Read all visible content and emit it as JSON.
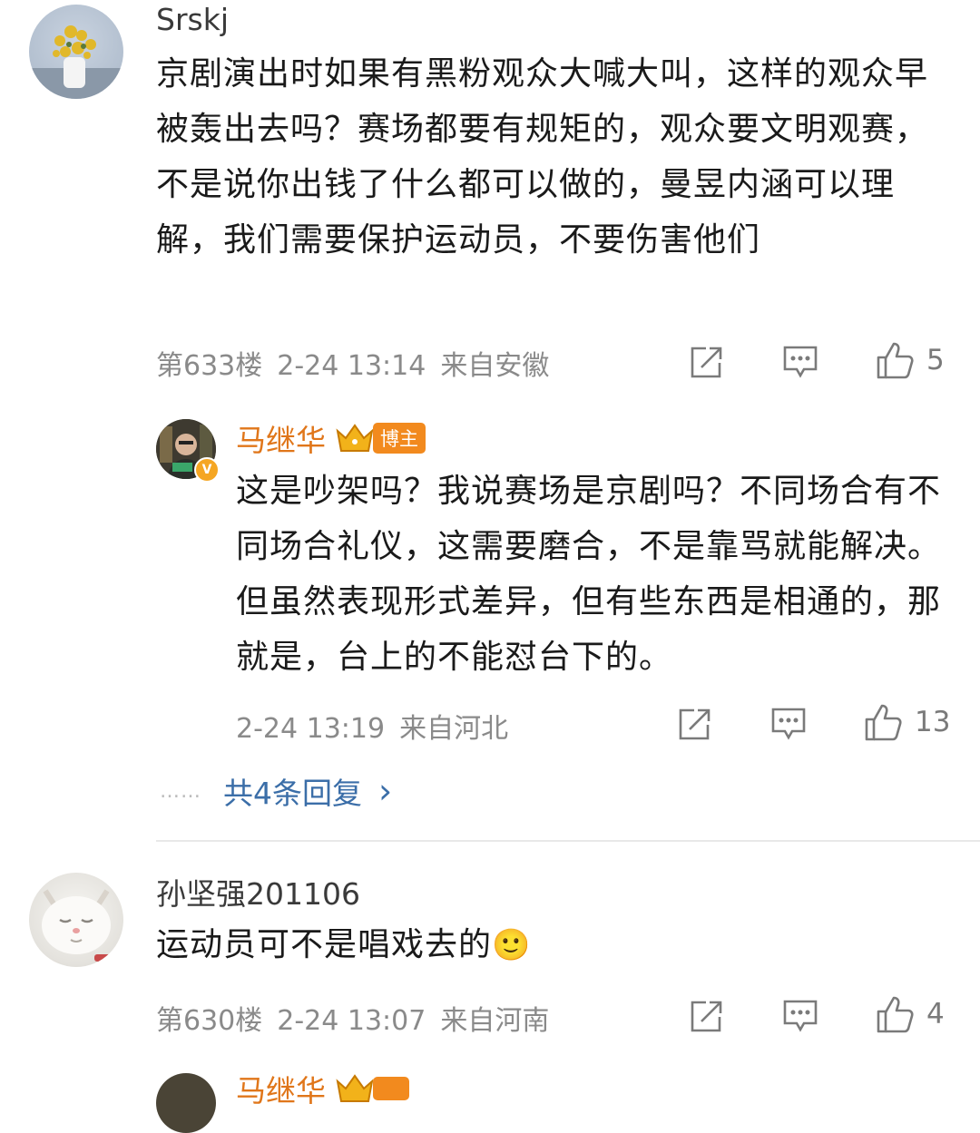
{
  "comments": [
    {
      "username": "Srskj",
      "text": "京剧演出时如果有黑粉观众大喊大叫，这样的观众早被轰出去吗？赛场都要有规矩的，观众要文明观赛，不是说你出钱了什么都可以做的，曼昱内涵可以理解，我们需要保护运动员，不要伤害他们",
      "floor": "第633楼",
      "time": "2-24 13:14",
      "location": "来自安徽",
      "likes": "5"
    },
    {
      "username": "孙坚强201106",
      "text": "运动员可不是唱戏去的",
      "emoji": "🙂",
      "floor": "第630楼",
      "time": "2-24 13:07",
      "location": "来自河南",
      "likes": "4"
    }
  ],
  "reply": {
    "username": "马继华",
    "badge": "博主",
    "verified_mark": "V",
    "text": "这是吵架吗？我说赛场是京剧吗？不同场合有不同场合礼仪，这需要磨合，不是靠骂就能解决。但虽然表现形式差异，但有些东西是相通的，那就是，台上的不能怼台下的。",
    "time": "2-24 13:19",
    "location": "来自河北",
    "likes": "13"
  },
  "more_replies": {
    "dots": "……",
    "label": "共4条回复",
    "arrow": "›"
  },
  "partial_next": {
    "username": "马继华"
  },
  "icons": [
    "share-icon",
    "comment-icon",
    "like-icon",
    "crown-icon",
    "chevron-right-icon"
  ],
  "colors": {
    "accent_orange": "#e0761a",
    "badge_orange": "#f28a1e",
    "link_blue": "#3b6ea8",
    "meta_gray": "#8a8a8a"
  }
}
